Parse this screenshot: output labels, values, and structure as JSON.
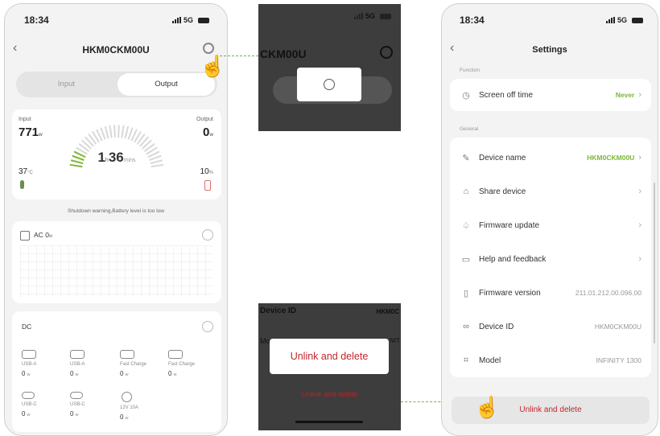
{
  "status": {
    "time": "18:34",
    "network": "5G"
  },
  "left_phone": {
    "title": "HKM0CKM00U",
    "tabs": {
      "input": "Input",
      "output": "Output"
    },
    "gauge": {
      "input_label": "Input",
      "input_value": "771",
      "input_unit": "w",
      "output_label": "Output",
      "output_value": "0",
      "output_unit": "w",
      "time_hours": "1",
      "time_h_unit": "h",
      "time_mins": "36",
      "time_mins_unit": "mins",
      "temp_value": "37",
      "temp_unit": "°C",
      "battery_value": "10",
      "battery_unit": "%"
    },
    "warning": "Shutdown warning,Battery level is too low",
    "ac": {
      "label": "AC",
      "value": "0",
      "unit": "w"
    },
    "dc": {
      "label": "DC",
      "ports": [
        {
          "name": "USB-A",
          "value": "0",
          "unit": "w",
          "icon": "usb-a-icon"
        },
        {
          "name": "USB-A",
          "value": "0",
          "unit": "w",
          "icon": "usb-a-icon"
        },
        {
          "name": "Fast Charge",
          "value": "0",
          "unit": "w",
          "icon": "fast-charge-icon"
        },
        {
          "name": "Fast Charge",
          "value": "0",
          "unit": "w",
          "icon": "fast-charge-icon"
        },
        {
          "name": "USB-C",
          "value": "0",
          "unit": "w",
          "icon": "usb-c-icon"
        },
        {
          "name": "USB-C",
          "value": "0",
          "unit": "w",
          "icon": "usb-c-icon"
        },
        {
          "name": "12V 10A",
          "value": "0",
          "unit": "w",
          "icon": "car-port-icon"
        }
      ]
    }
  },
  "zoom_top": {
    "title_fragment": "CKM00U",
    "network": "5G"
  },
  "zoom_bottom": {
    "device_id_fragment": "Device ID",
    "device_id_value_fragment": "HKM0C",
    "model_fragment": "Mo",
    "model_value_fragment": "NIT",
    "unlink_popup": "Unlink and delete",
    "unlink_bg": "Unlink and delete"
  },
  "right_phone": {
    "title": "Settings",
    "section_function": "Function",
    "screen_off": {
      "label": "Screen off time",
      "value": "Never"
    },
    "section_general": "General",
    "rows": [
      {
        "label": "Device name",
        "value": "HKM0CKM00U",
        "chevron": true,
        "highlight": true,
        "icon": "pencil-icon"
      },
      {
        "label": "Share device",
        "value": "",
        "chevron": true,
        "icon": "share-icon"
      },
      {
        "label": "Firmware update",
        "value": "",
        "chevron": true,
        "icon": "bell-icon"
      },
      {
        "label": "Help and feedback",
        "value": "",
        "chevron": true,
        "icon": "book-icon"
      },
      {
        "label": "Firmware version",
        "value": "211.01.212.00.096.00",
        "chevron": false,
        "icon": "chip-icon"
      },
      {
        "label": "Device ID",
        "value": "HKM0CKM00U",
        "chevron": false,
        "icon": "link-icon"
      },
      {
        "label": "Model",
        "value": "INFINITY 1300",
        "chevron": false,
        "icon": "scan-icon"
      }
    ],
    "unlink": "Unlink and delete"
  },
  "colors": {
    "accent_green": "#7bb733",
    "danger_red": "#c0262e",
    "dark_bg": "#3d3d3d"
  }
}
